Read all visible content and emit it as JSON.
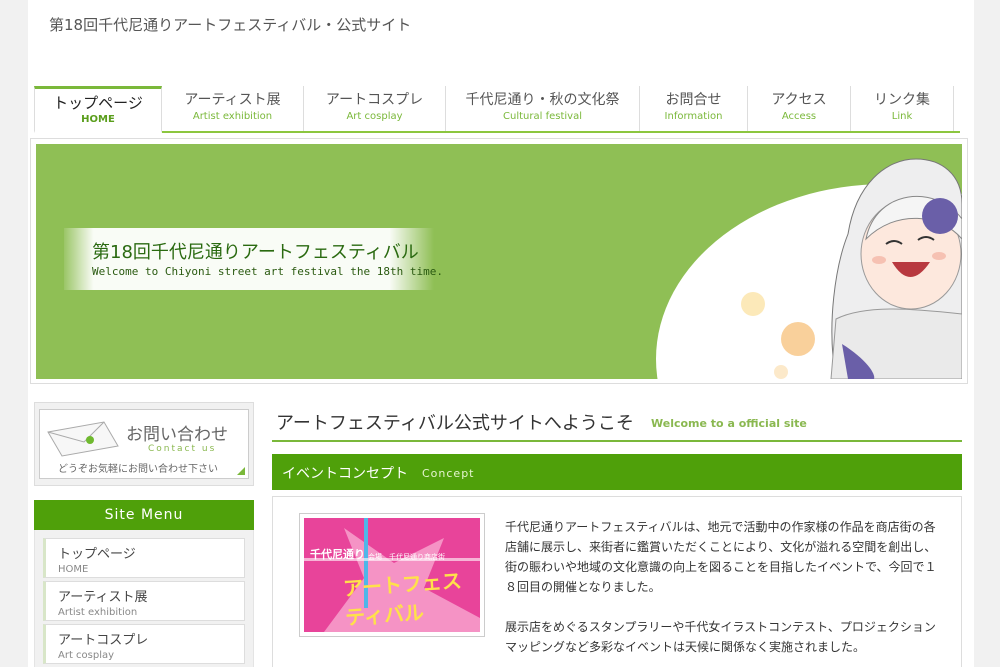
{
  "site": {
    "title": "第18回千代尼通りアートフェスティバル・公式サイト"
  },
  "nav": {
    "items": [
      {
        "jp": "トップページ",
        "en": "HOME"
      },
      {
        "jp": "アーティスト展",
        "en": "Artist exhibition"
      },
      {
        "jp": "アートコスプレ",
        "en": "Art cosplay"
      },
      {
        "jp": "千代尼通り・秋の文化祭",
        "en": "Cultural festival"
      },
      {
        "jp": "お問合せ",
        "en": "Information"
      },
      {
        "jp": "アクセス",
        "en": "Access"
      },
      {
        "jp": "リンク集",
        "en": "Link"
      }
    ]
  },
  "hero": {
    "title": "第18回千代尼通りアートフェスティバル",
    "subtitle": "Welcome to Chiyoni street art festival the 18th time."
  },
  "sidebar": {
    "contact": {
      "title": "お問い合わせ",
      "en": "Contact us",
      "note": "どうぞお気軽にお問い合わせ下さい"
    },
    "menu_head": "Site Menu",
    "menu": [
      {
        "jp": "トップページ",
        "en": "HOME"
      },
      {
        "jp": "アーティスト展",
        "en": "Artist exhibition"
      },
      {
        "jp": "アートコスプレ",
        "en": "Art cosplay"
      }
    ]
  },
  "main": {
    "welcome_jp": "アートフェスティバル公式サイトへようこそ",
    "welcome_en": "Welcome to a official site",
    "concept_jp": "イベントコンセプト",
    "concept_en": "Concept",
    "poster": {
      "t1": "千代尼通り",
      "t2": "会場　千代尼通り商店街",
      "t3": "アートフェスティバル"
    },
    "para1": "千代尼通りアートフェスティバルは、地元で活動中の作家様の作品を商店街の各店舗に展示し、来街者に鑑賞いただくことにより、文化が溢れる空間を創出し、街の賑わいや地域の文化意識の向上を図ることを目指したイベントで、今回で１８回目の開催となりました。",
    "para2": "展示店をめぐるスタンプラリーや千代女イラストコンテスト、プロジェクションマッピングなど多彩なイベントは天候に関係なく実施されました。"
  },
  "colors": {
    "accent": "#4fa00a",
    "hero_bg": "#8fbf55",
    "nav_en": "#7ab83a"
  }
}
